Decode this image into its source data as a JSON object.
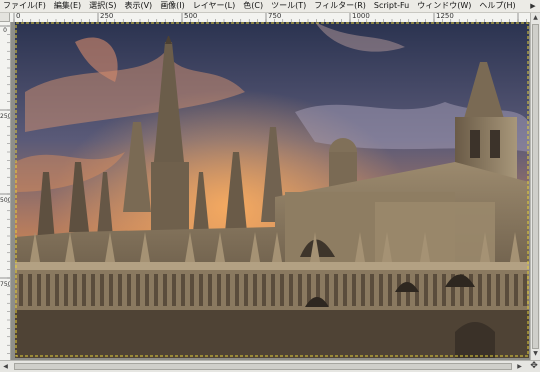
{
  "menubar": {
    "items": [
      {
        "label": "ファイル(F)"
      },
      {
        "label": "編集(E)"
      },
      {
        "label": "選択(S)"
      },
      {
        "label": "表示(V)"
      },
      {
        "label": "画像(I)"
      },
      {
        "label": "レイヤー(L)"
      },
      {
        "label": "色(C)"
      },
      {
        "label": "ツール(T)"
      },
      {
        "label": "フィルター(R)"
      },
      {
        "label": "Script-Fu"
      },
      {
        "label": "ウィンドウ(W)"
      },
      {
        "label": "ヘルプ(H)"
      }
    ],
    "overflow_icon": "chevron-right-icon"
  },
  "rulers": {
    "horizontal_labels": [
      "0",
      "250",
      "500",
      "750",
      "1000",
      "1250"
    ],
    "vertical_labels": [
      "0",
      "250",
      "500",
      "750"
    ]
  },
  "canvas": {
    "image_subject": "Gothic cathedral at dramatic sunset sky"
  },
  "colors": {
    "menubar_bg": "#ecebe6",
    "canvas_bg": "#8e8e8a",
    "selection_border": "#e6d23a"
  },
  "scrollbars": {
    "nav_icon": "navigate-icon"
  }
}
